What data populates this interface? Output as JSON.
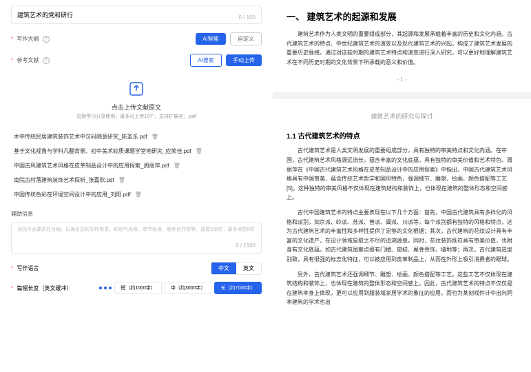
{
  "form": {
    "title_value": "建筑艺术的党和研行",
    "title_counter": "0 / 100",
    "outline_label": "写作大纲",
    "btn_ai": "AI智能",
    "btn_custom": "自定义",
    "refs_label": "参考文献",
    "btn_ai_search": "AI搜索",
    "btn_upload": "手动上传",
    "dropzone_title": "点击上传文献原文",
    "dropzone_sub": "仅限学习分享使用，最多可上传10个，支持扩展名：.pdf",
    "files": [
      "木中传统民居建筑装饰艺术中汉码随意研究_陈圣乐.pdf",
      "基于文化视角与学科凡翻背景、初中美术较质课题学堂地研究_应笑佳.pdf",
      "中国古风建筑艺术风格在皮革制品设计中的应用探索_周丽萍.pdf",
      "南院古村落建筑装饰艺术探析_张嘉欣.pdf",
      "中国传统色彩在环境空间设计中的应用_刘阳.pdf"
    ],
    "aux_label": "辅助信息",
    "aux_placeholder": "添加不太要求在目纲。以满足您的写作需求，如语气风格、章节段落、额外创作想等。请按S添加，最多添加5项",
    "aux_counter": "0 / 1500",
    "style_label": "写作语言",
    "lang_cn": "中文",
    "lang_en": "英文",
    "length_label": "篇幅长度（英文缓冲）",
    "len_short": "短（约1000字）",
    "len_mid": "中（约3000字）",
    "len_long": "长（约7000字）"
  },
  "article": {
    "h2": "一、  建筑艺术的起源和发展",
    "p1": "建筑艺术作为人类文明的重要组成部分，其起源和发展承载着丰富的历史和文化内涵。古代建筑艺术的特点、中世纪建筑艺术的演变以及现代建筑艺术的兴起，构成了建筑艺术发展的重要历史脉络。通过对这些时期的建筑艺术特点和演变进行深入研究，可以更好地理解建筑艺术在不同历史时期的文化背景下所承载的意义和价值。",
    "page_ind": "- 1 -",
    "subtitle_center": "建筑艺术的研究与探讨",
    "h3": "1.1  古代建筑艺术的特点",
    "p2": "古代建筑艺术是人类文明发展的重要组成部分，具有独特的审美特点和文化内涵。在中国，古代建筑艺术风格源远流长，蕴含丰富的文化底蕴，具有独特的审美价值和艺术特色。周丽萍在《中国古代建筑艺术风格在皮革制品设计中的应用探索》中指出，中国古代建筑艺术风格具有中国审美、蕴含传统艺术哲学和国风特色，强调细节、雕塑、绘画、颜色搭配等工艺[5]。这种独特的审美风格不仅体现在建筑结构和装饰上，也体现在建筑的整体形态和空间感上。",
    "p3": "古代中国建筑艺术的特点主要表现在以下几个方面：首先，中国古代建筑具有多样化的风格和派别，如京派、岭派、苏派、普派、闽派、川派等，每个派别都有独特的风格和特点，这为古代建筑艺术的丰富性和多样性提供了足够的文化根据；其次，古代建筑的花纹设计具有丰富的文化遗产，在设计领域是取之不尽的追溯源泉。同时，花纹装饰既符具有审美价值，也附身有文化底蕴。如古代建筑图案点缀有门楣、窗棂、屋脊脊饰、墙地等；再次，古代建筑造型别致，具有很强的标志化特征，可以被应用到皮革制品上，从而在外形上吸引消费者的眼球。",
    "p4": "另外，古代建筑艺术还强调细节、雕塑、绘画、颜色搭配等工艺。这些工艺不仅体现在建筑结构和装饰上，也体现在建筑的整体形态和空间感上。因此，古代建筑艺术的特点不仅仅是在建筑本身上体现，更可以应用到服装域家居学术的象征的应用，而也为某刻戏件计中出向同本建筑的学术也出"
  }
}
